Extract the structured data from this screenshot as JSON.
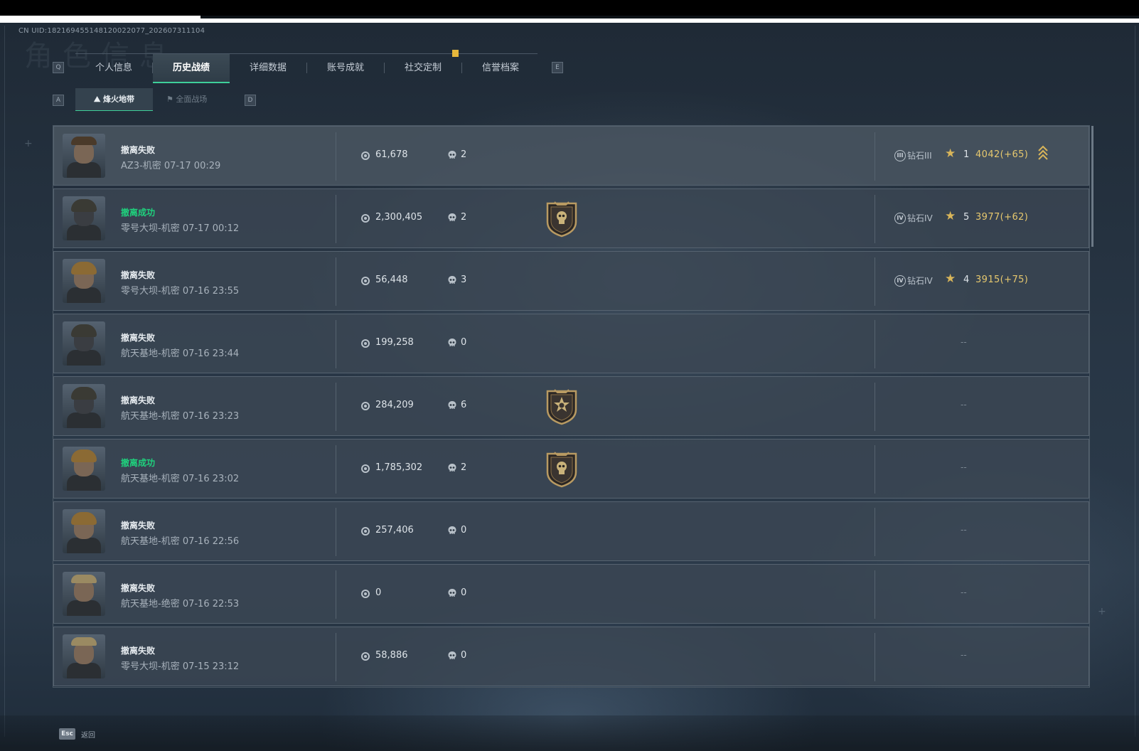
{
  "uid": "CN UID:18216945514812002​2077_202607311104",
  "watermark": "角色信息",
  "keys": {
    "prev_tab": "Q",
    "next_tab": "E",
    "prev_sub": "A",
    "next_sub": "D"
  },
  "tabs": [
    {
      "label": "个人信息",
      "active": false
    },
    {
      "label": "历史战绩",
      "active": true
    },
    {
      "label": "详细数据",
      "active": false
    },
    {
      "label": "账号成就",
      "active": false
    },
    {
      "label": "社交定制",
      "active": false
    },
    {
      "label": "信誉档案",
      "active": false
    }
  ],
  "subtabs": [
    {
      "label": "烽火地带",
      "active": true
    },
    {
      "label": "全面战场",
      "active": false
    }
  ],
  "records": [
    {
      "status": "撤离失败",
      "success": false,
      "map": "AZ3-机密 07-17 00:29",
      "coins": "61,678",
      "kills": "2",
      "badge": "",
      "rank_numeral": "III",
      "rank": "钻石III",
      "stars": "1",
      "score": "4042(+65)",
      "rank_up": true,
      "portrait": "brown"
    },
    {
      "status": "撤离成功",
      "success": true,
      "map": "零号大坝-机密 07-17 00:12",
      "coins": "2,300,405",
      "kills": "2",
      "badge": "shield-skull",
      "rank_numeral": "IV",
      "rank": "钻石IV",
      "stars": "5",
      "score": "3977(+62)",
      "rank_up": false,
      "portrait": "mask"
    },
    {
      "status": "撤离失败",
      "success": false,
      "map": "零号大坝-机密 07-16 23:55",
      "coins": "56,448",
      "kills": "3",
      "badge": "",
      "rank_numeral": "IV",
      "rank": "钻石IV",
      "stars": "4",
      "score": "3915(+75)",
      "rank_up": false,
      "portrait": "gold"
    },
    {
      "status": "撤离失败",
      "success": false,
      "map": "航天基地-机密 07-16 23:44",
      "coins": "199,258",
      "kills": "0",
      "badge": "",
      "rank": "",
      "score": "",
      "dash": "--",
      "portrait": "mask"
    },
    {
      "status": "撤离失败",
      "success": false,
      "map": "航天基地-机密 07-16 23:23",
      "coins": "284,209",
      "kills": "6",
      "badge": "shield-star",
      "rank": "",
      "score": "",
      "dash": "--",
      "portrait": "mask"
    },
    {
      "status": "撤离成功",
      "success": true,
      "map": "航天基地-机密 07-16 23:02",
      "coins": "1,785,302",
      "kills": "2",
      "badge": "shield-skull",
      "rank": "",
      "score": "",
      "dash": "--",
      "portrait": "gold"
    },
    {
      "status": "撤离失败",
      "success": false,
      "map": "航天基地-机密 07-16 22:56",
      "coins": "257,406",
      "kills": "0",
      "badge": "",
      "rank": "",
      "score": "",
      "dash": "--",
      "portrait": "gold"
    },
    {
      "status": "撤离失败",
      "success": false,
      "map": "航天基地-绝密 07-16 22:53",
      "coins": "0",
      "kills": "0",
      "badge": "",
      "rank": "",
      "score": "",
      "dash": "--",
      "portrait": "blond"
    },
    {
      "status": "撤离失败",
      "success": false,
      "map": "零号大坝-机密 07-15 23:12",
      "coins": "58,886",
      "kills": "0",
      "badge": "",
      "rank": "",
      "score": "",
      "dash": "--",
      "portrait": "blond"
    }
  ],
  "footer": {
    "esc_key": "Esc",
    "esc_label": "返回"
  },
  "colors": {
    "success": "#1fd17d",
    "accent": "#3ecf9a",
    "gold": "#d8b55a",
    "score": "#e6c86e"
  }
}
